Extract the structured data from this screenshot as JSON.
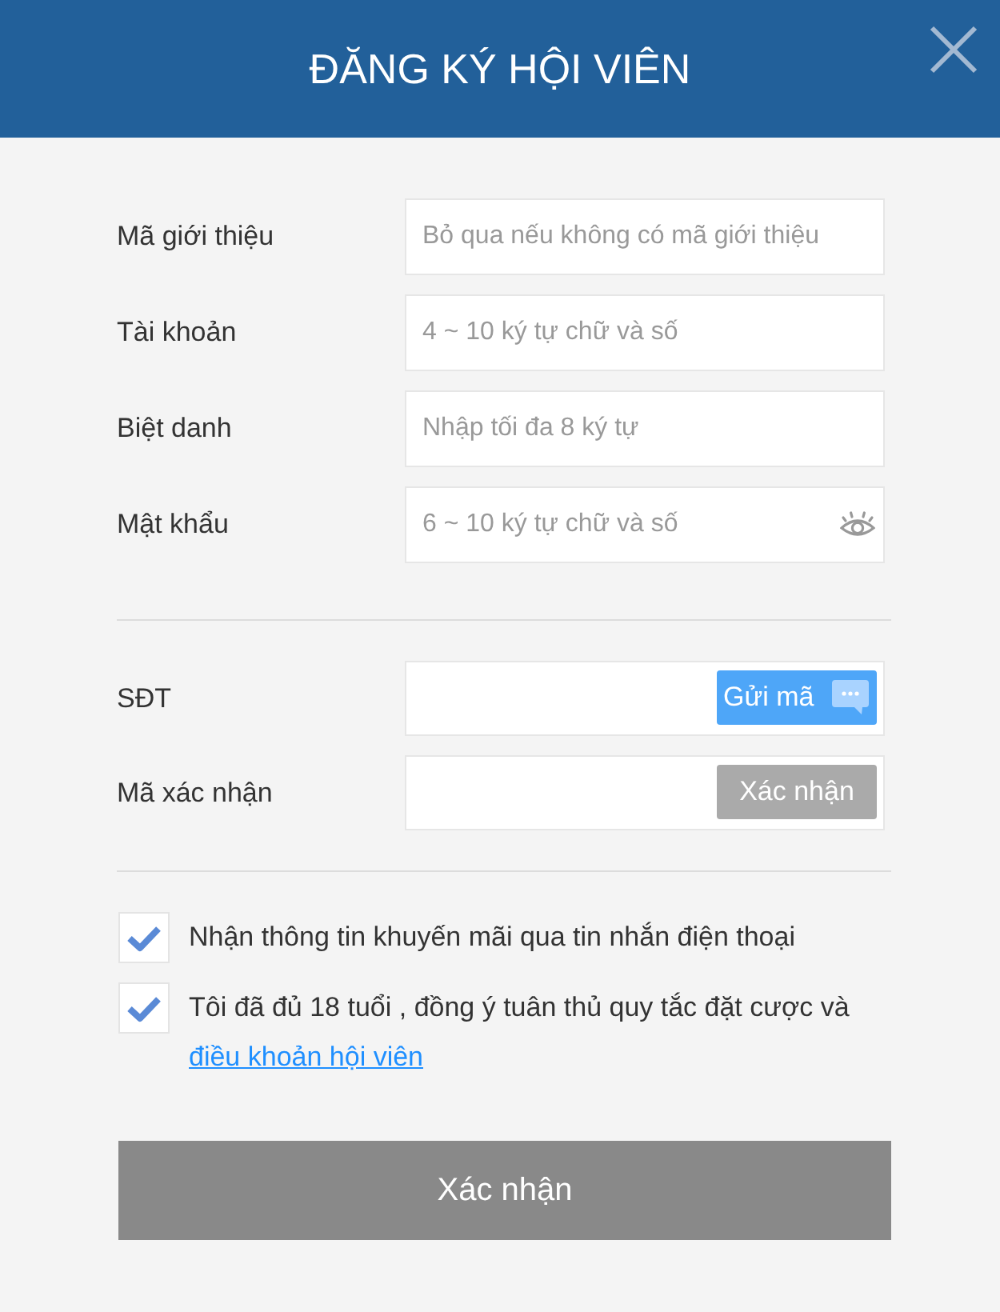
{
  "header": {
    "title": "ĐĂNG KÝ HỘI VIÊN"
  },
  "fields": [
    {
      "kind": "text",
      "label": "Mã giới thiệu",
      "placeholder": "Bỏ qua nếu không có mã giới thiệu"
    },
    {
      "kind": "text",
      "label": "Tài khoản",
      "placeholder": "4 ~ 10 ký tự chữ và số"
    },
    {
      "kind": "text",
      "label": "Biệt danh",
      "placeholder": "Nhập tối đa 8 ký tự"
    },
    {
      "kind": "password",
      "label": "Mật khẩu",
      "placeholder": "6 ~ 10 ký tự chữ và số"
    }
  ],
  "verify_fields": [
    {
      "label": "SĐT",
      "button": {
        "kind": "send",
        "label": "Gửi mã",
        "disabled": false
      }
    },
    {
      "label": "Mã xác nhận",
      "button": {
        "kind": "confirm",
        "label": "Xác nhận",
        "disabled": true
      }
    }
  ],
  "agreements": [
    {
      "text": "Nhận thông tin khuyến mãi qua tin nhắn điện thoại",
      "checked": true
    },
    {
      "text": "Tôi đã đủ 18 tuổi , đồng ý tuân thủ quy tắc đặt cược và",
      "link": "điều khoản hội viên",
      "checked": true
    }
  ],
  "submit": {
    "label": "Xác nhận",
    "disabled": true
  }
}
